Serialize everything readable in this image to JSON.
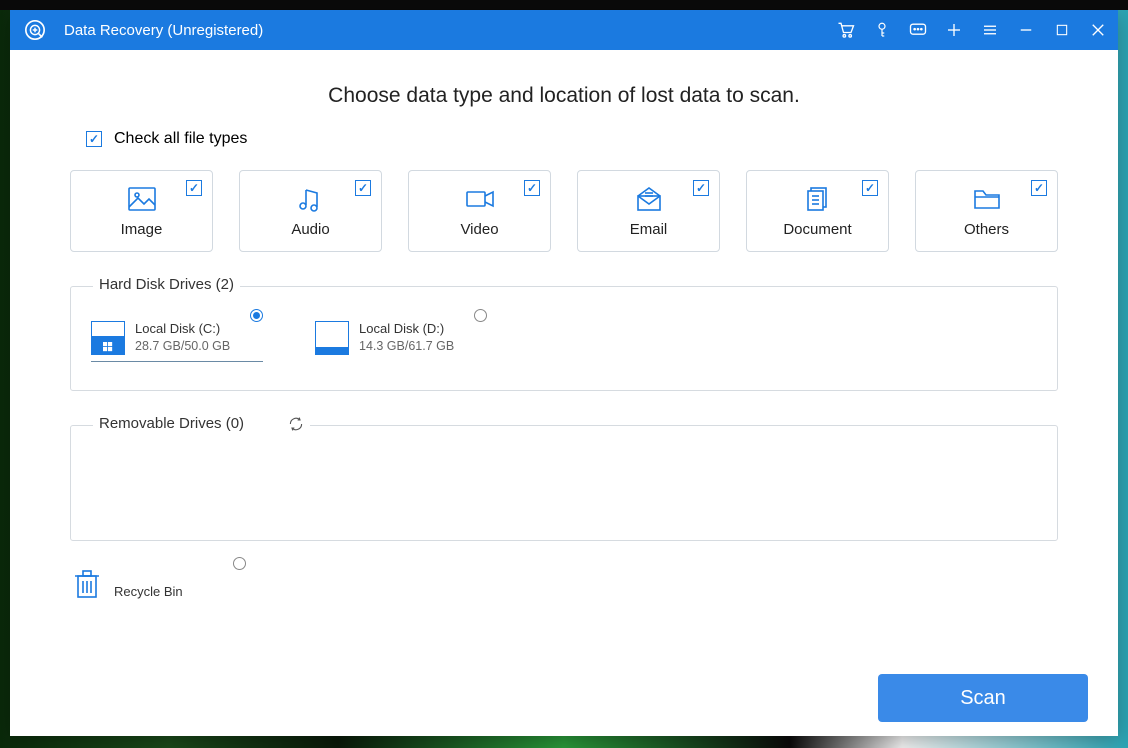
{
  "window": {
    "title": "Data Recovery (Unregistered)"
  },
  "heading": "Choose data type and location of lost data to scan.",
  "check_all": {
    "label": "Check all file types",
    "checked": true
  },
  "file_types": [
    {
      "id": "image",
      "label": "Image",
      "checked": true
    },
    {
      "id": "audio",
      "label": "Audio",
      "checked": true
    },
    {
      "id": "video",
      "label": "Video",
      "checked": true
    },
    {
      "id": "email",
      "label": "Email",
      "checked": true
    },
    {
      "id": "document",
      "label": "Document",
      "checked": true
    },
    {
      "id": "others",
      "label": "Others",
      "checked": true
    }
  ],
  "hard_disk": {
    "title": "Hard Disk Drives (2)",
    "drives": [
      {
        "name": "Local Disk (C:)",
        "size": "28.7 GB/50.0 GB",
        "fill_pct": 57,
        "os": true,
        "selected": true
      },
      {
        "name": "Local Disk (D:)",
        "size": "14.3 GB/61.7 GB",
        "fill_pct": 23,
        "os": false,
        "selected": false
      }
    ]
  },
  "removable": {
    "title": "Removable Drives (0)"
  },
  "recycle": {
    "label": "Recycle Bin",
    "selected": false
  },
  "scan_label": "Scan",
  "titlebar_icons": [
    "cart",
    "key",
    "chat",
    "plus",
    "menu",
    "minimize",
    "maximize",
    "close"
  ],
  "colors": {
    "primary": "#1b7ae0"
  }
}
